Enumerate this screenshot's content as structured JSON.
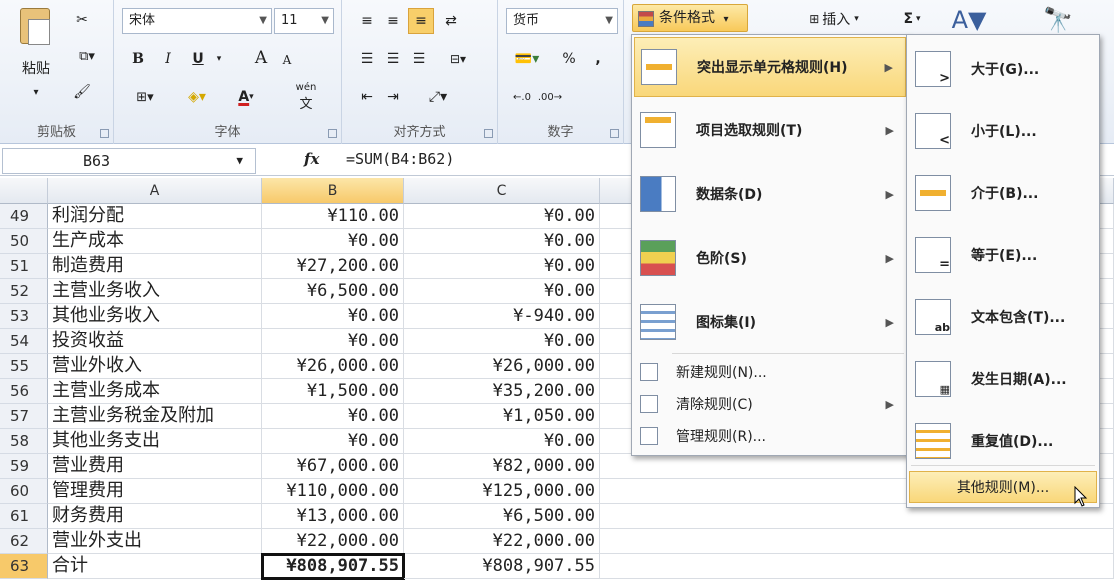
{
  "ribbon": {
    "clipboard": {
      "label": "剪贴板",
      "paste": "粘贴"
    },
    "font": {
      "label": "字体",
      "name": "宋体",
      "size": "11",
      "bold": "B",
      "italic": "I",
      "underline": "U",
      "grow": "A",
      "shrink": "A",
      "phonetic": "wén"
    },
    "alignment": {
      "label": "对齐方式"
    },
    "number": {
      "label": "数字",
      "format": "货币",
      "percent": "%",
      "comma": ","
    },
    "styles": {
      "conditional_format": "条件格式"
    },
    "cells": {
      "insert": "插入"
    },
    "editing": {
      "sum": "Σ"
    }
  },
  "formula_bar": {
    "name_box": "B63",
    "fx": "fx",
    "formula": "=SUM(B4:B62)"
  },
  "columns": [
    "A",
    "B",
    "C"
  ],
  "rows": [
    {
      "n": "49",
      "a": "利润分配",
      "b": "¥110.00",
      "c": "¥0.00"
    },
    {
      "n": "50",
      "a": "生产成本",
      "b": "¥0.00",
      "c": "¥0.00"
    },
    {
      "n": "51",
      "a": "制造费用",
      "b": "¥27,200.00",
      "c": "¥0.00"
    },
    {
      "n": "52",
      "a": "主营业务收入",
      "b": "¥6,500.00",
      "c": "¥0.00"
    },
    {
      "n": "53",
      "a": "其他业务收入",
      "b": "¥0.00",
      "c": "¥-940.00"
    },
    {
      "n": "54",
      "a": "投资收益",
      "b": "¥0.00",
      "c": "¥0.00"
    },
    {
      "n": "55",
      "a": "营业外收入",
      "b": "¥26,000.00",
      "c": "¥26,000.00"
    },
    {
      "n": "56",
      "a": "主营业务成本",
      "b": "¥1,500.00",
      "c": "¥35,200.00"
    },
    {
      "n": "57",
      "a": "主营业务税金及附加",
      "b": "¥0.00",
      "c": "¥1,050.00"
    },
    {
      "n": "58",
      "a": "其他业务支出",
      "b": "¥0.00",
      "c": "¥0.00"
    },
    {
      "n": "59",
      "a": "营业费用",
      "b": "¥67,000.00",
      "c": "¥82,000.00"
    },
    {
      "n": "60",
      "a": "管理费用",
      "b": "¥110,000.00",
      "c": "¥125,000.00"
    },
    {
      "n": "61",
      "a": "财务费用",
      "b": "¥13,000.00",
      "c": "¥6,500.00"
    },
    {
      "n": "62",
      "a": "营业外支出",
      "b": "¥22,000.00",
      "c": "¥22,000.00"
    },
    {
      "n": "63",
      "a": "合计",
      "b": "¥808,907.55",
      "c": "¥808,907.55"
    }
  ],
  "menu_main": {
    "items": [
      {
        "label": "突出显示单元格规则(H)"
      },
      {
        "label": "项目选取规则(T)"
      },
      {
        "label": "数据条(D)"
      },
      {
        "label": "色阶(S)"
      },
      {
        "label": "图标集(I)"
      }
    ],
    "small_items": [
      {
        "label": "新建规则(N)..."
      },
      {
        "label": "清除规则(C)"
      },
      {
        "label": "管理规则(R)..."
      }
    ]
  },
  "menu_sub": {
    "items": [
      {
        "label": "大于(G)..."
      },
      {
        "label": "小于(L)..."
      },
      {
        "label": "介于(B)..."
      },
      {
        "label": "等于(E)..."
      },
      {
        "label": "文本包含(T)..."
      },
      {
        "label": "发生日期(A)..."
      },
      {
        "label": "重复值(D)..."
      }
    ],
    "more": "其他规则(M)..."
  },
  "colors": {
    "highlight": "#f9d77a",
    "selected_col": "#f7c96a"
  }
}
